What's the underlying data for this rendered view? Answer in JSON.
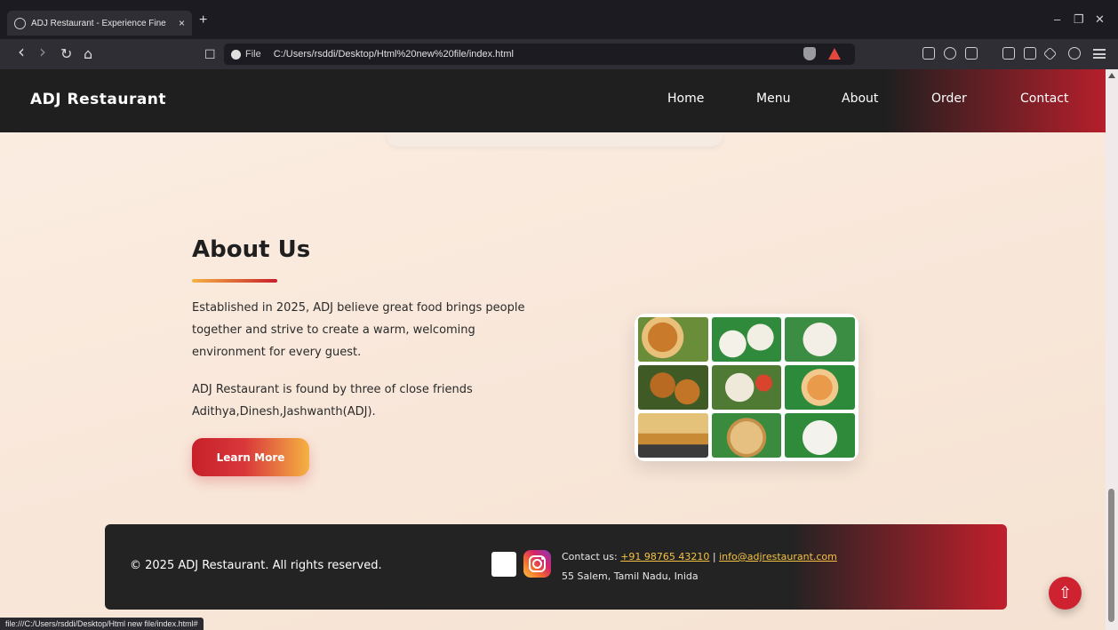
{
  "browser": {
    "tab_title": "ADJ Restaurant - Experience Fine",
    "tab_close": "×",
    "new_tab": "+",
    "url_scheme_label": "File",
    "url": "C:/Users/rsddi/Desktop/Html%20new%20file/index.html",
    "nav_back": "‹",
    "nav_forward": "›",
    "nav_reload": "↻",
    "nav_home": "⌂",
    "bookmark": "☐",
    "win_min": "–",
    "win_restore": "❐",
    "win_close": "✕",
    "status_url": "file:///C:/Users/rsddi/Desktop/Html new file/index.html#"
  },
  "site": {
    "brand": "ADJ Restaurant",
    "nav": [
      "Home",
      "Menu",
      "About",
      "Order",
      "Contact"
    ]
  },
  "about": {
    "title": "About Us",
    "paragraph1": "Established in 2025, ADJ believe great food brings people together and strive to create a warm, welcoming environment for every guest.",
    "paragraph2": "ADJ Restaurant is found by three of close friends Adithya,Dinesh,Jashwanth(ADJ).",
    "button": "Learn More"
  },
  "footer": {
    "copyright": "© 2025 ADJ Restaurant. All rights reserved.",
    "contact_prefix": "Contact us:",
    "phone": "+91 98765 43210",
    "separator": "|",
    "email": "info@adjrestaurant.com",
    "address": "55 Salem, Tamil Nadu, Inida"
  },
  "back_to_top": "⇧",
  "colors": {
    "accent_red": "#c8202b",
    "accent_gold": "#f5b243",
    "header_dark": "#1f1f1f"
  }
}
